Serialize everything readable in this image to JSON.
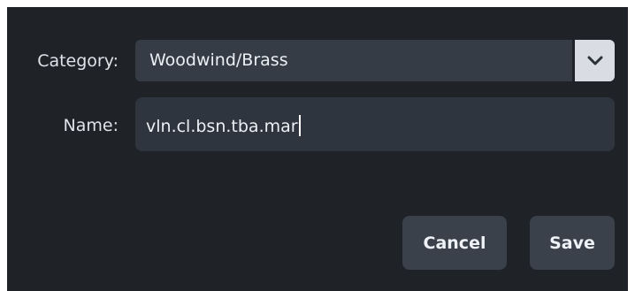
{
  "form": {
    "category_label": "Category:",
    "category_value": "Woodwind/Brass",
    "name_label": "Name:",
    "name_value": "vln.cl.bsn.tba.mar"
  },
  "buttons": {
    "cancel_label": "Cancel",
    "save_label": "Save"
  },
  "icons": {
    "dropdown": "chevron-down-icon"
  },
  "colors": {
    "dialog_bg": "#1f2328",
    "field_bg": "#353c46",
    "button_bg": "#3a414b",
    "chevron_bg": "#d9dde3"
  }
}
